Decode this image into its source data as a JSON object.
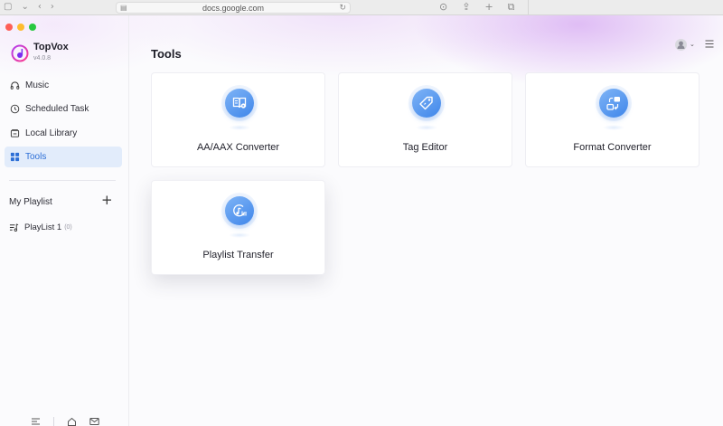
{
  "browser": {
    "url": "docs.google.com"
  },
  "app": {
    "name": "TopVox",
    "version": "v4.0.8"
  },
  "sidebar": {
    "items": [
      {
        "label": "Music",
        "icon": "headphones-icon"
      },
      {
        "label": "Scheduled Task",
        "icon": "clock-icon"
      },
      {
        "label": "Local Library",
        "icon": "library-icon"
      },
      {
        "label": "Tools",
        "icon": "grid-icon",
        "active": true
      }
    ],
    "playlist_title": "My Playlist",
    "add_label": "+",
    "playlists": [
      {
        "label": "PlayList 1",
        "count": "(0)"
      }
    ]
  },
  "main": {
    "title": "Tools",
    "tools": [
      {
        "label": "AA/AAX Converter",
        "icon": "audiobook-icon"
      },
      {
        "label": "Tag Editor",
        "icon": "tag-icon"
      },
      {
        "label": "Format Converter",
        "icon": "format-convert-icon"
      },
      {
        "label": "Playlist Transfer",
        "icon": "playlist-transfer-icon"
      }
    ]
  },
  "colors": {
    "accent": "#2d6fd6",
    "active_bg": "#e2ecfb",
    "icon_gradient_start": "#7fb4f6",
    "icon_gradient_end": "#3f86ea"
  }
}
